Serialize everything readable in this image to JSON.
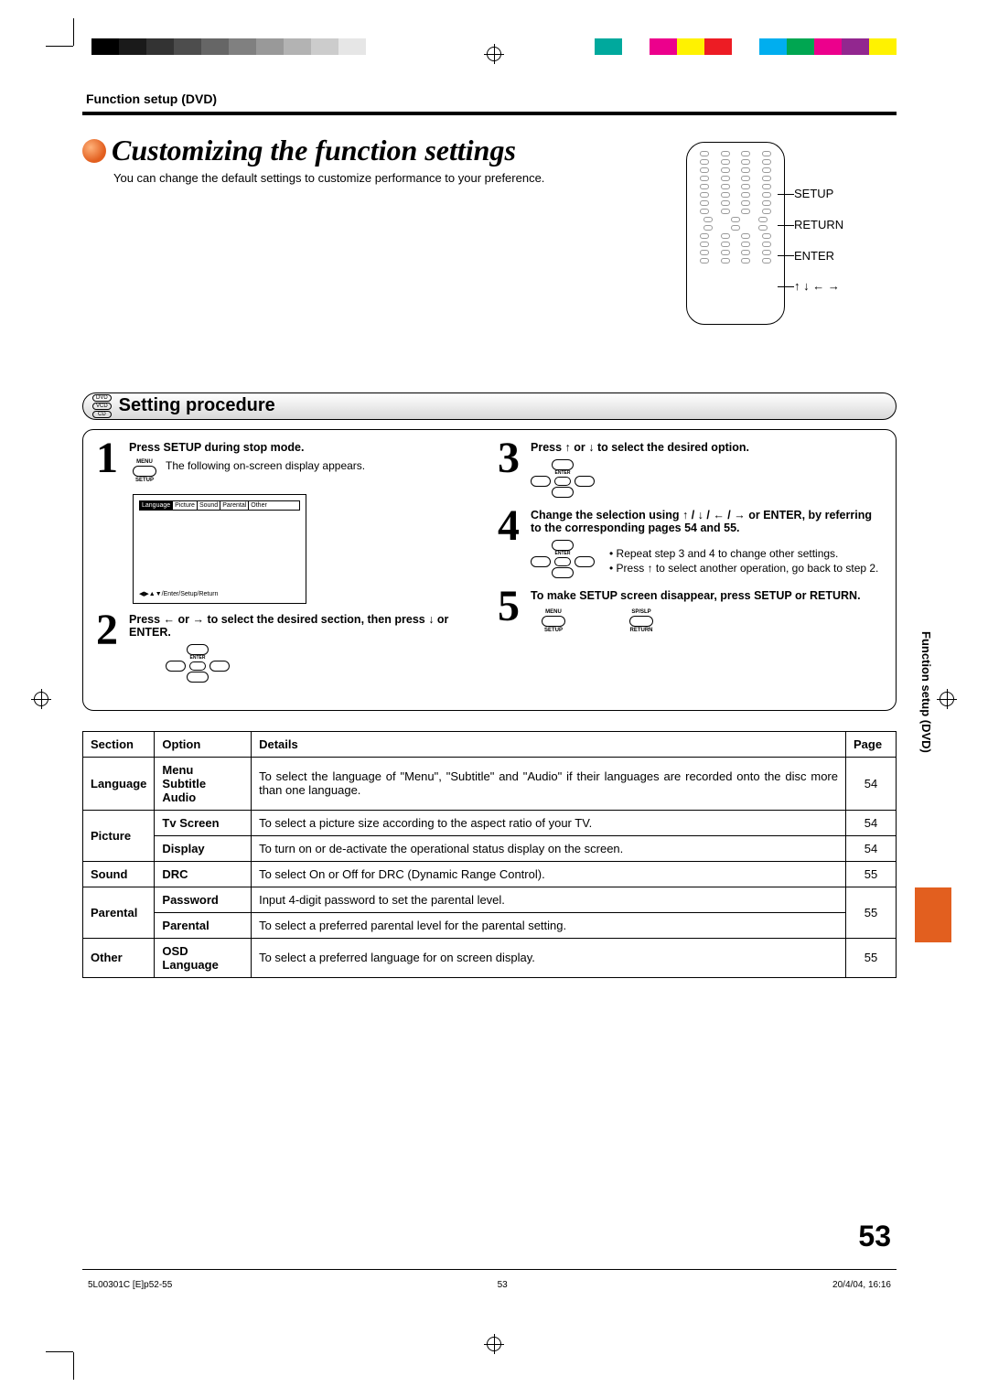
{
  "header": {
    "section_label": "Function setup (DVD)",
    "title": "Customizing the function settings",
    "intro": "You can change the default settings to customize performance to your preference."
  },
  "remote": {
    "labels": [
      "SETUP",
      "RETURN",
      "ENTER",
      "↑ ↓ ← →"
    ]
  },
  "section_bar": {
    "discs": [
      "DVD",
      "VCD",
      "CD"
    ],
    "title": "Setting procedure"
  },
  "steps": {
    "s1": {
      "title": "Press SETUP during stop mode.",
      "desc": "The following on-screen display appears.",
      "btn_top": "MENU",
      "btn_bottom": "SETUP",
      "osd_tabs": [
        "Language",
        "Picture",
        "Sound",
        "Parental",
        "Other"
      ],
      "osd_hint": "◀▶▲▼/Enter/Setup/Return"
    },
    "s2": {
      "title_a": "Press ",
      "title_b": " or ",
      "title_c": " to select the desired section, then press ",
      "title_d": " or ENTER.",
      "left": "←",
      "right": "→",
      "down": "↓",
      "enter": "ENTER"
    },
    "s3": {
      "title_a": "Press ",
      "title_b": " or ",
      "title_c": " to select the desired option.",
      "up": "↑",
      "down": "↓",
      "enter": "ENTER"
    },
    "s4": {
      "title_a": "Change the selection using ",
      "arrows": "↑ / ↓ / ← / →",
      "title_b": " or ENTER, by referring to the corresponding pages 54 and 55.",
      "bullet1": "Repeat step 3 and 4 to change other settings.",
      "bullet2_a": "Press ",
      "bullet2_arrow": "↑",
      "bullet2_b": " to select another operation, go back to step 2.",
      "enter": "ENTER"
    },
    "s5": {
      "title": "To make SETUP screen disappear, press SETUP or RETURN.",
      "b1_top": "MENU",
      "b1_bottom": "SETUP",
      "b2_top": "SP/SLP",
      "b2_bottom": "RETURN"
    }
  },
  "table": {
    "headers": [
      "Section",
      "Option",
      "Details",
      "Page"
    ],
    "rows": [
      {
        "section": "Language",
        "option": "Menu\nSubtitle\nAudio",
        "details": "To select the language of \"Menu\", \"Subtitle\" and \"Audio\" if their languages are recorded onto the disc more than one language.",
        "page": "54"
      },
      {
        "section": "Picture",
        "section_rowspan": 2,
        "option": "Tv Screen",
        "details": "To select a picture size according to the aspect ratio of your TV.",
        "page": "54"
      },
      {
        "option": "Display",
        "details": "To turn on or de-activate the operational status display on the screen.",
        "page": "54"
      },
      {
        "section": "Sound",
        "option": "DRC",
        "details": "To select On or Off for DRC (Dynamic Range Control).",
        "page": "55"
      },
      {
        "section": "Parental",
        "section_rowspan": 2,
        "option": "Password",
        "details": "Input 4-digit password to set the parental level.",
        "page": "55",
        "page_rowspan": 2
      },
      {
        "option": "Parental",
        "details": "To select a preferred parental level for the parental setting."
      },
      {
        "section": "Other",
        "option": "OSD Language",
        "details": "To select a preferred language for on screen display.",
        "page": "55"
      }
    ]
  },
  "side_tab": "Function setup (DVD)",
  "page_number": "53",
  "footer": {
    "left": "5L00301C [E]p52-55",
    "mid": "53",
    "right": "20/4/04, 16:16"
  },
  "colors": {
    "bw": [
      "#000000",
      "#1a1a1a",
      "#333333",
      "#4d4d4d",
      "#666666",
      "#808080",
      "#999999",
      "#b3b3b3",
      "#cccccc",
      "#e6e6e6",
      "#ffffff"
    ],
    "col": [
      "#00a99d",
      "#ffffff",
      "#ec008c",
      "#fff200",
      "#ed1c24",
      "#ffffff",
      "#00aeef",
      "#00a651",
      "#ec008c",
      "#92278f",
      "#fff200"
    ]
  }
}
